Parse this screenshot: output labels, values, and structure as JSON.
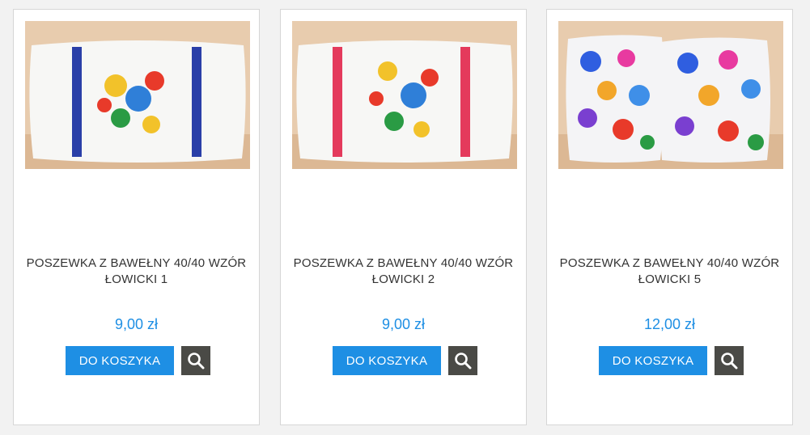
{
  "colors": {
    "accent": "#1e8fe4",
    "zoom_bg": "#4a4a46",
    "text": "#333333"
  },
  "products": [
    {
      "title": "POSZEWKA Z BAWEŁNY 40/40 WZÓR ŁOWICKI 1",
      "price": "9,00 zł",
      "cart_label": "DO KOSZYKA",
      "image_desc": "white pillow blue trim floral",
      "zoom_icon": "search-icon"
    },
    {
      "title": "POSZEWKA Z BAWEŁNY 40/40 WZÓR ŁOWICKI 2",
      "price": "9,00 zł",
      "cart_label": "DO KOSZYKA",
      "image_desc": "white pillow red trim floral",
      "zoom_icon": "search-icon"
    },
    {
      "title": "POSZEWKA Z BAWEŁNY 40/40 WZÓR ŁOWICKI 5",
      "price": "12,00 zł",
      "cart_label": "DO KOSZYKA",
      "image_desc": "floral print pillows",
      "zoom_icon": "search-icon"
    }
  ]
}
